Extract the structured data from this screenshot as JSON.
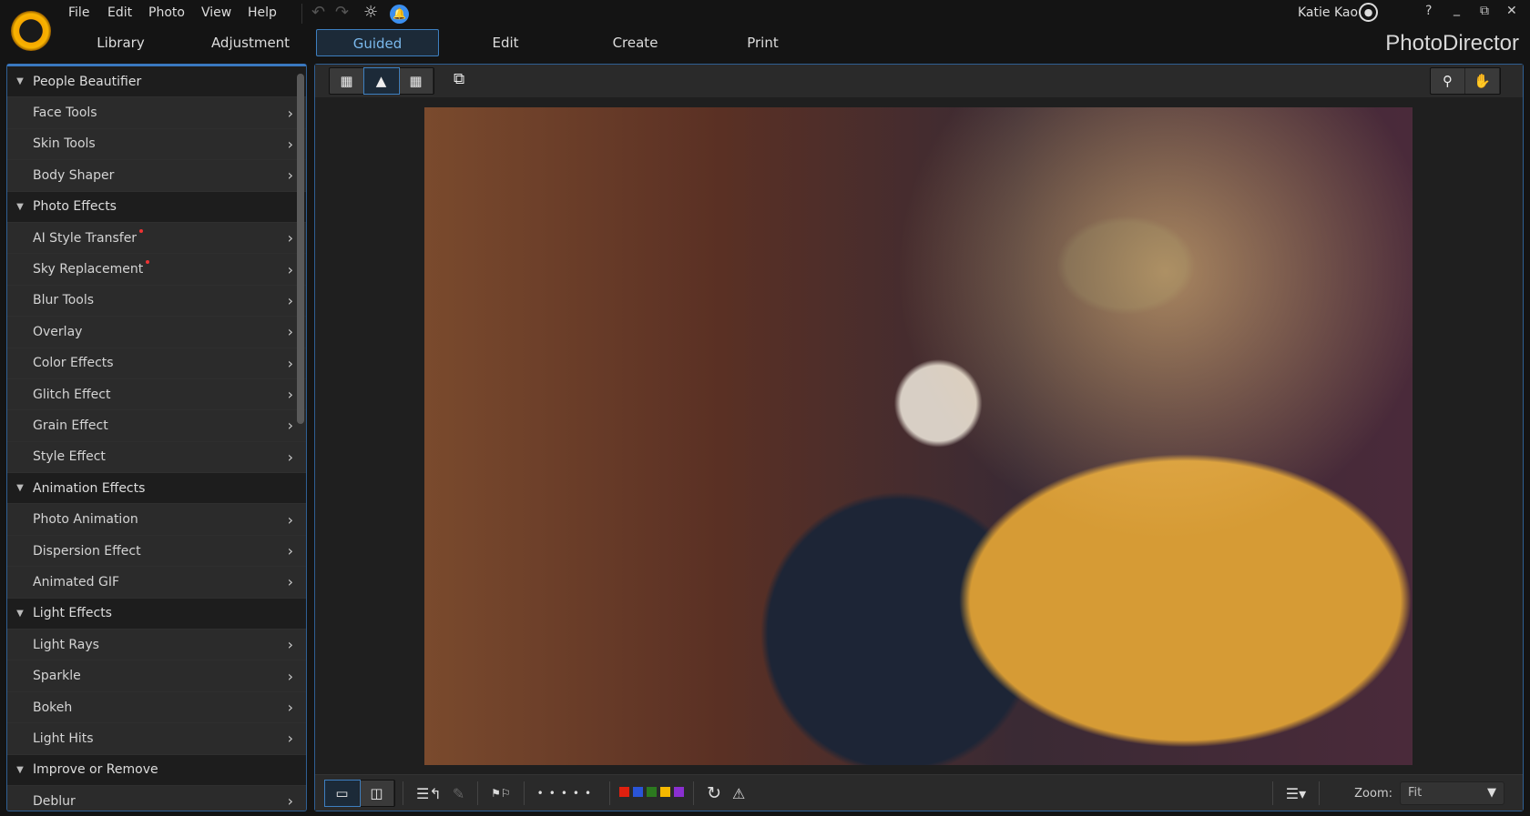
{
  "menu": [
    "File",
    "Edit",
    "Photo",
    "View",
    "Help"
  ],
  "user": {
    "name": "Katie Kao"
  },
  "window": {
    "help": "?",
    "minimize": "_",
    "restore": "⧉",
    "close": "✕"
  },
  "tabs": [
    {
      "label": "Library"
    },
    {
      "label": "Adjustment"
    },
    {
      "label": "Guided",
      "active": true
    },
    {
      "label": "Edit"
    },
    {
      "label": "Create"
    },
    {
      "label": "Print"
    }
  ],
  "brand": "PhotoDirector",
  "sidebar": [
    {
      "group": "People Beautifier",
      "items": [
        {
          "label": "Face Tools"
        },
        {
          "label": "Skin Tools"
        },
        {
          "label": "Body Shaper"
        }
      ]
    },
    {
      "group": "Photo Effects",
      "items": [
        {
          "label": "AI Style Transfer",
          "new": true
        },
        {
          "label": "Sky Replacement",
          "new": true
        },
        {
          "label": "Blur Tools"
        },
        {
          "label": "Overlay"
        },
        {
          "label": "Color Effects"
        },
        {
          "label": "Glitch Effect"
        },
        {
          "label": "Grain Effect"
        },
        {
          "label": "Style Effect"
        }
      ]
    },
    {
      "group": "Animation Effects",
      "items": [
        {
          "label": "Photo Animation"
        },
        {
          "label": "Dispersion Effect"
        },
        {
          "label": "Animated GIF"
        }
      ]
    },
    {
      "group": "Light Effects",
      "items": [
        {
          "label": "Light Rays"
        },
        {
          "label": "Sparkle"
        },
        {
          "label": "Bokeh"
        },
        {
          "label": "Light Hits"
        }
      ]
    },
    {
      "group": "Improve or Remove",
      "items": [
        {
          "label": "Deblur"
        }
      ]
    }
  ],
  "bottom": {
    "zoom_label": "Zoom:",
    "zoom_value": "Fit",
    "color_labels": [
      "#e0200f",
      "#2a55d8",
      "#2c7a1f",
      "#f5b800",
      "#8a2fd0"
    ]
  }
}
